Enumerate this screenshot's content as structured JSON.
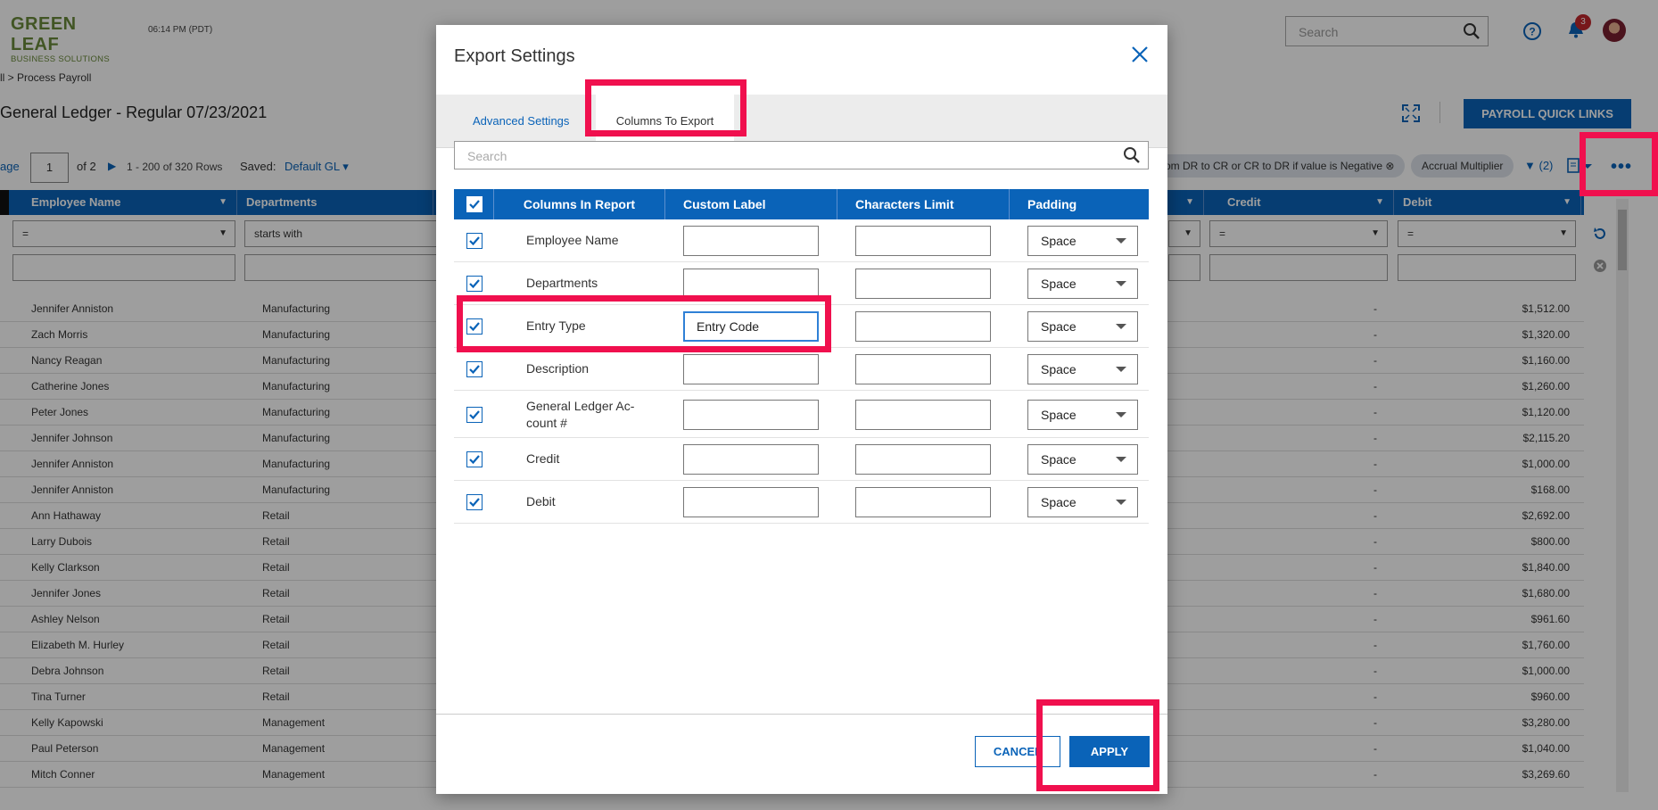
{
  "app": {
    "logo_top": "GREEN LEAF",
    "logo_bottom": "BUSINESS SOLUTIONS",
    "time": "06:14 PM (PDT)",
    "search_placeholder": "Search",
    "notification_count": "3"
  },
  "breadcrumb": "ll > Process Payroll",
  "page_title": "General Ledger - Regular 07/23/2021",
  "quick_links_label": "PAYROLL QUICK LINKS",
  "pager": {
    "page_label": "age",
    "current_page": "1",
    "of_pages": "of 2",
    "range": "1 - 200 of 320 Rows",
    "saved_label": "Saved:",
    "saved_value": "Default GL ▾"
  },
  "chips": [
    "rom DR to CR or CR to DR if value is Negative ⊗",
    "Accrual Multiplier"
  ],
  "filter_count": "(2)",
  "table": {
    "headers": [
      "Employee Name",
      "Departments",
      "Credit",
      "Debit"
    ],
    "filter_values": [
      "=",
      "starts with",
      "=",
      "=",
      "="
    ],
    "rows": [
      {
        "name": "Jennifer Anniston",
        "dept": "Manufacturing",
        "credit": "-",
        "debit": "$1,512.00"
      },
      {
        "name": "Zach Morris",
        "dept": "Manufacturing",
        "credit": "-",
        "debit": "$1,320.00"
      },
      {
        "name": "Nancy Reagan",
        "dept": "Manufacturing",
        "credit": "-",
        "debit": "$1,160.00"
      },
      {
        "name": "Catherine Jones",
        "dept": "Manufacturing",
        "credit": "-",
        "debit": "$1,260.00"
      },
      {
        "name": "Peter Jones",
        "dept": "Manufacturing",
        "credit": "-",
        "debit": "$1,120.00"
      },
      {
        "name": "Jennifer Johnson",
        "dept": "Manufacturing",
        "credit": "-",
        "debit": "$2,115.20"
      },
      {
        "name": "Jennifer Anniston",
        "dept": "Manufacturing",
        "credit": "-",
        "debit": "$1,000.00"
      },
      {
        "name": "Jennifer Anniston",
        "dept": "Manufacturing",
        "credit": "-",
        "debit": "$168.00"
      },
      {
        "name": "Ann Hathaway",
        "dept": "Retail",
        "credit": "-",
        "debit": "$2,692.00"
      },
      {
        "name": "Larry Dubois",
        "dept": "Retail",
        "credit": "-",
        "debit": "$800.00"
      },
      {
        "name": "Kelly Clarkson",
        "dept": "Retail",
        "credit": "-",
        "debit": "$1,840.00"
      },
      {
        "name": "Jennifer Jones",
        "dept": "Retail",
        "credit": "-",
        "debit": "$1,680.00"
      },
      {
        "name": "Ashley Nelson",
        "dept": "Retail",
        "credit": "-",
        "debit": "$961.60"
      },
      {
        "name": "Elizabeth M. Hurley",
        "dept": "Retail",
        "credit": "-",
        "debit": "$1,760.00"
      },
      {
        "name": "Debra Johnson",
        "dept": "Retail",
        "credit": "-",
        "debit": "$1,000.00"
      },
      {
        "name": "Tina Turner",
        "dept": "Retail",
        "credit": "-",
        "debit": "$960.00"
      },
      {
        "name": "Kelly Kapowski",
        "dept": "Management",
        "credit": "-",
        "debit": "$3,280.00"
      },
      {
        "name": "Paul Peterson",
        "dept": "Management",
        "credit": "-",
        "debit": "$1,040.00"
      },
      {
        "name": "Mitch Conner",
        "dept": "Management",
        "credit": "-",
        "debit": "$3,269.60"
      }
    ]
  },
  "modal": {
    "title": "Export Settings",
    "tabs": [
      "Advanced Settings",
      "Columns To Export"
    ],
    "search_placeholder": "Search",
    "headers": [
      "Columns In Report",
      "Custom Label",
      "Characters Limit",
      "Padding"
    ],
    "rows": [
      {
        "column": "Employee Name",
        "custom_label": "",
        "chars_limit": "",
        "padding": "Space"
      },
      {
        "column": "Departments",
        "custom_label": "",
        "chars_limit": "",
        "padding": "Space"
      },
      {
        "column": "Entry Type",
        "custom_label": "Entry Code",
        "chars_limit": "",
        "padding": "Space"
      },
      {
        "column": "Description",
        "custom_label": "",
        "chars_limit": "",
        "padding": "Space"
      },
      {
        "column": "General Ledger Ac-count #",
        "custom_label": "",
        "chars_limit": "",
        "padding": "Space"
      },
      {
        "column": "Credit",
        "custom_label": "",
        "chars_limit": "",
        "padding": "Space"
      },
      {
        "column": "Debit",
        "custom_label": "",
        "chars_limit": "",
        "padding": "Space"
      }
    ],
    "cancel_label": "CANCEL",
    "apply_label": "APPLY"
  },
  "colors": {
    "primary": "#0a63b8",
    "highlight": "#f0104e",
    "badge": "#c0272d"
  }
}
